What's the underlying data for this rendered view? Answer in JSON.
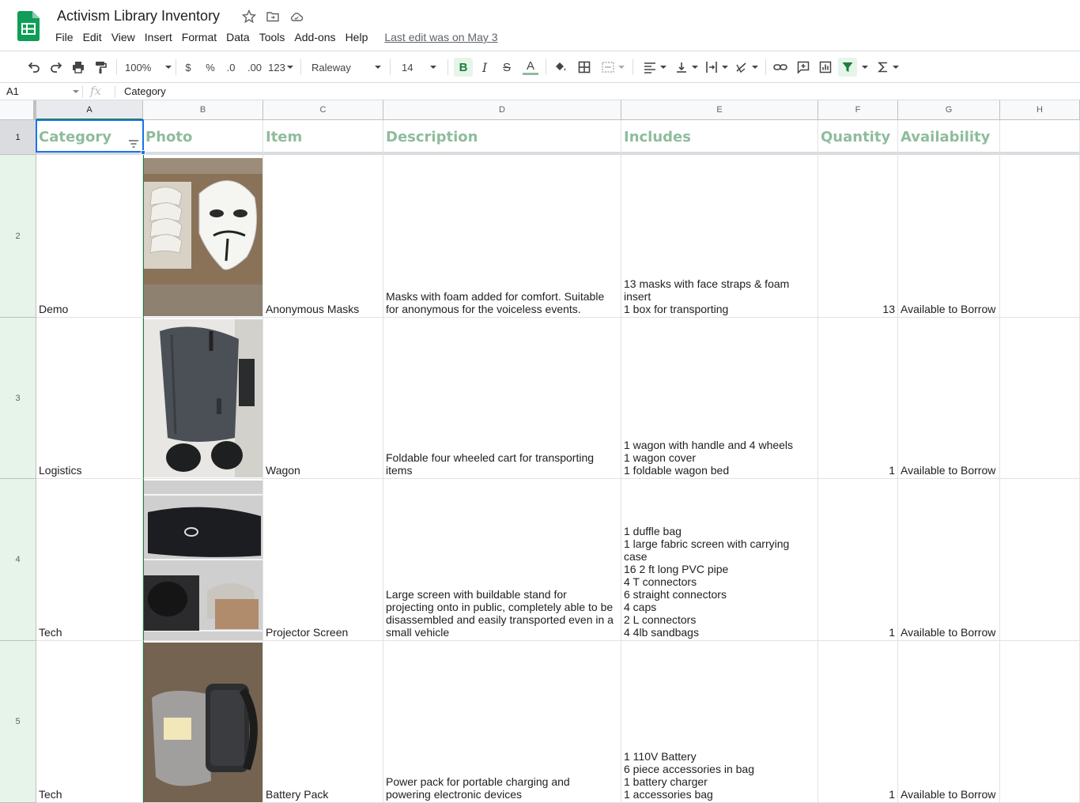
{
  "app": {
    "title": "Activism Library Inventory",
    "last_edit": "Last edit was on May 3",
    "menu": [
      "File",
      "Edit",
      "View",
      "Insert",
      "Format",
      "Data",
      "Tools",
      "Add-ons",
      "Help"
    ]
  },
  "toolbar": {
    "zoom": "100%",
    "currency": "$",
    "percent": "%",
    "dec_less": ".0",
    "dec_more": ".00",
    "more_formats": "123",
    "font": "Raleway",
    "font_size": "14",
    "bold_label": "B",
    "italic_label": "I",
    "strike_label": "S",
    "text_color_label": "A"
  },
  "formula": {
    "cell_ref": "A1",
    "fx": "fx",
    "value": "Category"
  },
  "colors": {
    "header_text": "#8fbc9c",
    "selection": "#1a73e8",
    "sheets_green": "#188038",
    "row_header_bg": "#e6f4ea"
  },
  "columns": [
    "A",
    "B",
    "C",
    "D",
    "E",
    "F",
    "G",
    "H"
  ],
  "rows": [
    "1",
    "2",
    "3",
    "4",
    "5"
  ],
  "headers": {
    "category": "Category",
    "photo": "Photo",
    "item": "Item",
    "description": "Description",
    "includes": "Includes",
    "quantity": "Quantity",
    "availability": "Availability"
  },
  "items": [
    {
      "category": "Demo",
      "photo": "masks-photo",
      "item": "Anonymous Masks",
      "description": "Masks with foam added for comfort. Suitable\nfor anonymous for the voiceless events.",
      "includes": "13 masks with face straps & foam insert\n1 box for transporting",
      "quantity": "13",
      "availability": "Available to Borrow"
    },
    {
      "category": "Logistics",
      "photo": "wagon-photo",
      "item": "Wagon",
      "description": "Foldable four wheeled cart for transporting\nitems",
      "includes": "1 wagon with handle and 4 wheels\n1 wagon cover\n1 foldable wagon bed",
      "quantity": "1",
      "availability": "Available to Borrow"
    },
    {
      "category": "Tech",
      "photo": "projector-screen-photo",
      "item": "Projector Screen",
      "description": "Large screen with buildable stand for\nprojecting onto in public, completely able to be\ndisassembled and easily transported even in a\nsmall vehicle",
      "includes": "1 duffle bag\n1 large fabric screen with carrying case\n16 2 ft long PVC pipe\n4 T connectors\n6 straight connectors\n4 caps\n2 L connectors\n4 4lb sandbags",
      "quantity": "1",
      "availability": "Available to Borrow"
    },
    {
      "category": "Tech",
      "photo": "battery-pack-photo",
      "item": "Battery Pack",
      "description": "Power pack for portable charging and\npowering electronic devices",
      "includes": "1 110V Battery\n6 piece accessories in bag\n1 battery charger\n1 accessories bag",
      "quantity": "1",
      "availability": "Available to Borrow"
    }
  ]
}
